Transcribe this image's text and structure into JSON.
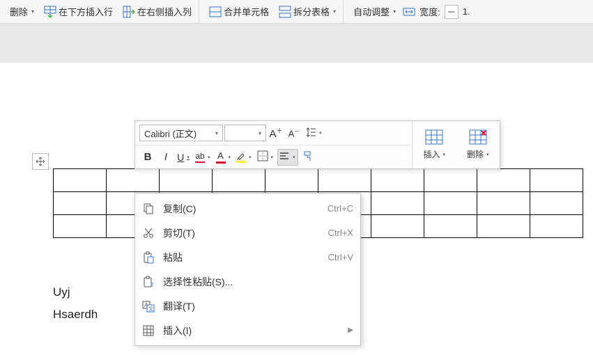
{
  "ribbon": {
    "delete": "删除",
    "insertRowBelow": "在下方插入行",
    "insertColRight": "在右侧插入列",
    "mergeCells": "合并单元格",
    "splitTable": "拆分表格",
    "autoFit": "自动调整",
    "widthLabel": "宽度:",
    "widthValue": "1."
  },
  "mini": {
    "fontName": "Calibri (正文)",
    "fontSize": "",
    "insert": "插入",
    "delete": "删除",
    "bold": "B",
    "italic": "I",
    "underline": "U",
    "biggerA": "A",
    "smallerA": "A",
    "plus": "＋",
    "minus": "－"
  },
  "context": {
    "copy": {
      "label": "复制(C)",
      "hotkey": "Ctrl+C"
    },
    "cut": {
      "label": "剪切(T)",
      "hotkey": "Ctrl+X"
    },
    "paste": {
      "label": "粘贴",
      "hotkey": "Ctrl+V"
    },
    "pasteSpecial": {
      "label": "选择性粘贴(S)...",
      "hotkey": ""
    },
    "translate": {
      "label": "翻译(T)",
      "hotkey": ""
    },
    "insert": {
      "label": "插入(I)",
      "hotkey": ""
    }
  },
  "body": {
    "line1": "Uyj",
    "line2": "Hsaerdh"
  },
  "icons": {
    "minus": "－"
  }
}
